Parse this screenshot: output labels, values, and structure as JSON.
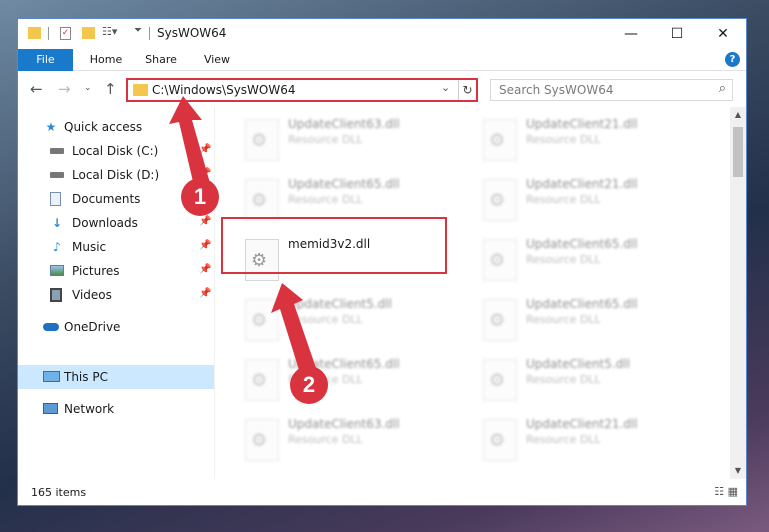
{
  "window": {
    "title": "SysWOW64",
    "controls": {
      "minimize": "—",
      "maximize": "☐",
      "close": "✕"
    }
  },
  "ribbon": {
    "tabs": [
      "File",
      "Home",
      "Share",
      "View"
    ],
    "help": "?"
  },
  "address": {
    "path": "C:\\Windows\\SysWOW64",
    "search_placeholder": "Search SysWOW64"
  },
  "sidebar": {
    "items": [
      {
        "label": "Quick access",
        "icon": "star-icon",
        "pinned": false
      },
      {
        "label": "Local Disk (C:)",
        "icon": "drive-icon",
        "pinned": true
      },
      {
        "label": "Local Disk (D:)",
        "icon": "drive-icon",
        "pinned": true
      },
      {
        "label": "Documents",
        "icon": "documents-icon",
        "pinned": true
      },
      {
        "label": "Downloads",
        "icon": "download-icon",
        "pinned": true
      },
      {
        "label": "Music",
        "icon": "music-icon",
        "pinned": true
      },
      {
        "label": "Pictures",
        "icon": "pictures-icon",
        "pinned": true
      },
      {
        "label": "Videos",
        "icon": "videos-icon",
        "pinned": true
      },
      {
        "label": "OneDrive",
        "icon": "cloud-icon",
        "pinned": false
      },
      {
        "label": "This PC",
        "icon": "computer-icon",
        "pinned": false,
        "selected": true
      },
      {
        "label": "Network",
        "icon": "network-icon",
        "pinned": false
      }
    ]
  },
  "files": {
    "left": [
      {
        "name": "UpdateClient63.dll",
        "type": "Resource DLL"
      },
      {
        "name": "UpdateClient65.dll",
        "type": "Resource DLL"
      },
      {
        "name": "memid3v2.dll",
        "type": ""
      },
      {
        "name": "UpdateClient5.dll",
        "type": "Resource DLL"
      },
      {
        "name": "UpdateClient65.dll",
        "type": "Resource DLL"
      },
      {
        "name": "UpdateClient63.dll",
        "type": "Resource DLL"
      }
    ],
    "right": [
      {
        "name": "UpdateClient21.dll",
        "type": "Resource DLL"
      },
      {
        "name": "UpdateClient21.dll",
        "type": "Resource DLL"
      },
      {
        "name": "UpdateClient65.dll",
        "type": "Resource DLL"
      },
      {
        "name": "UpdateClient65.dll",
        "type": "Resource DLL"
      },
      {
        "name": "UpdateClient5.dll",
        "type": "Resource DLL"
      },
      {
        "name": "UpdateClient21.dll",
        "type": "Resource DLL"
      }
    ]
  },
  "status": {
    "count": "165 items"
  },
  "annotations": {
    "step1": "1",
    "step2": "2",
    "color": "#d9333f"
  }
}
